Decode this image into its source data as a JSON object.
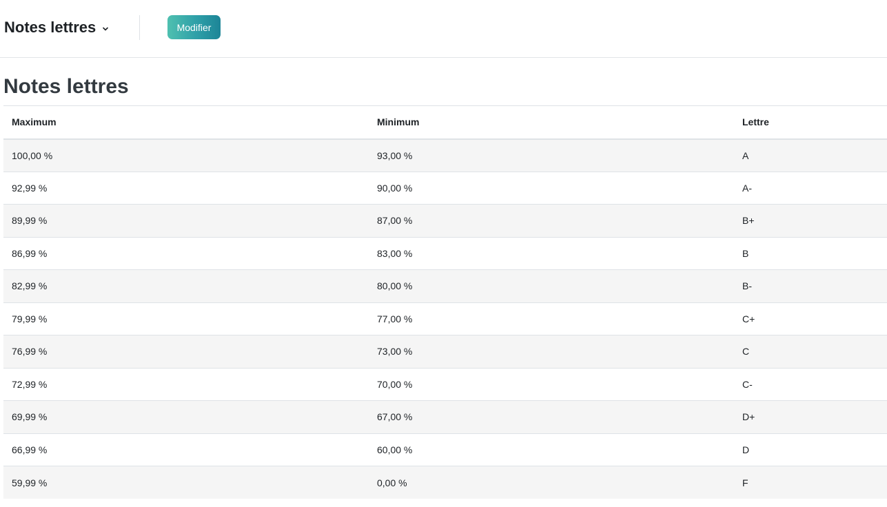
{
  "header": {
    "selector_label": "Notes lettres",
    "modify_label": "Modifier",
    "accent_gradient": [
      "#4fc0b0",
      "#1d8597"
    ]
  },
  "main": {
    "title": "Notes lettres",
    "table": {
      "headers": [
        "Maximum",
        "Minimum",
        "Lettre"
      ],
      "rows": [
        [
          "100,00 %",
          "93,00 %",
          "A"
        ],
        [
          "92,99 %",
          "90,00 %",
          "A-"
        ],
        [
          "89,99 %",
          "87,00 %",
          "B+"
        ],
        [
          "86,99 %",
          "83,00 %",
          "B"
        ],
        [
          "82,99 %",
          "80,00 %",
          "B-"
        ],
        [
          "79,99 %",
          "77,00 %",
          "C+"
        ],
        [
          "76,99 %",
          "73,00 %",
          "C"
        ],
        [
          "72,99 %",
          "70,00 %",
          "C-"
        ],
        [
          "69,99 %",
          "67,00 %",
          "D+"
        ],
        [
          "66,99 %",
          "60,00 %",
          "D"
        ],
        [
          "59,99 %",
          "0,00 %",
          "F"
        ]
      ]
    }
  }
}
